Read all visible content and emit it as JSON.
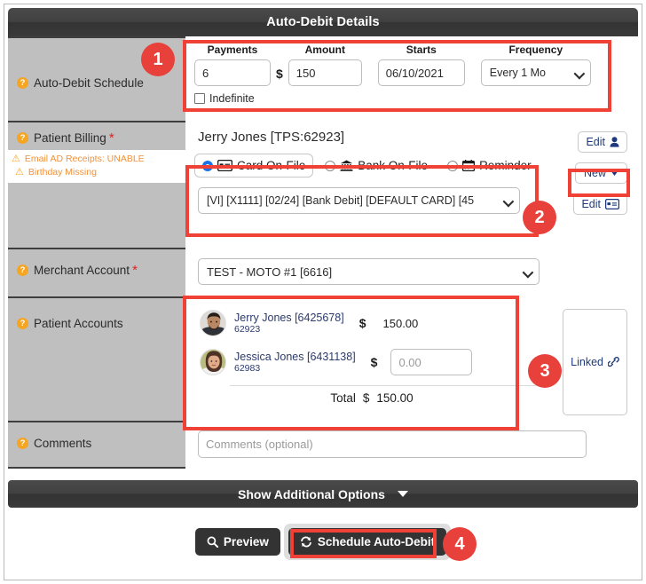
{
  "window": {
    "title": "Auto-Debit Details"
  },
  "schedule": {
    "label": "Auto-Debit Schedule",
    "help_icon": "question-circle-icon",
    "columns": {
      "payments": "Payments",
      "amount": "Amount",
      "starts": "Starts",
      "frequency": "Frequency"
    },
    "payments_value": "6",
    "currency_symbol": "$",
    "amount_value": "150",
    "starts_value": "06/10/2021",
    "frequency_value": "Every 1 Mo",
    "indefinite_label": "Indefinite",
    "indefinite_checked": false
  },
  "billing": {
    "label": "Patient Billing",
    "required_marker": "*",
    "warnings": [
      {
        "icon": "warning-triangle-icon",
        "text": "Email AD Receipts: UNABLE"
      },
      {
        "icon": "warning-triangle-icon",
        "text": "Birthday Missing"
      }
    ],
    "patient_name": "Jerry Jones [TPS:62923]",
    "edit_patient_label": "Edit",
    "edit_patient_icon": "person-icon",
    "methods": [
      {
        "label": "Card On-File",
        "icon": "credit-card-icon",
        "selected": true
      },
      {
        "label": "Bank On-File",
        "icon": "bank-icon",
        "selected": false
      },
      {
        "label": "Reminder",
        "icon": "calendar-icon",
        "selected": false
      }
    ],
    "card_value": "[VI] [X1111] [02/24] [Bank Debit] [DEFAULT CARD] [45",
    "new_label": "New",
    "new_caret_icon": "caret-down-icon",
    "edit_card_label": "Edit",
    "edit_card_icon": "credit-card-icon"
  },
  "merchant": {
    "label": "Merchant Account",
    "required_marker": "*",
    "value": "TEST - MOTO #1 [6616]"
  },
  "accounts": {
    "label": "Patient Accounts",
    "linked_label": "Linked",
    "linked_icon": "link-icon",
    "currency_symbol": "$",
    "rows": [
      {
        "name": "Jerry Jones [6425678]",
        "id": "62923",
        "amount": "150.00",
        "is_input": false,
        "avatar": "male-avatar"
      },
      {
        "name": "Jessica Jones [6431138]",
        "id": "62983",
        "amount": "",
        "placeholder": "0.00",
        "is_input": true,
        "avatar": "female-avatar"
      }
    ],
    "total_label": "Total",
    "total_amount": "150.00"
  },
  "comments": {
    "label": "Comments",
    "value": "",
    "placeholder": "Comments (optional)"
  },
  "additional_options": {
    "label": "Show Additional Options",
    "caret_icon": "caret-down-icon"
  },
  "footer": {
    "preview_label": "Preview",
    "preview_icon": "search-icon",
    "submit_label": "Schedule Auto-Debit",
    "submit_icon": "refresh-icon"
  },
  "annotations": {
    "badges": [
      "1",
      "2",
      "3",
      "4"
    ],
    "highlight_color": "#ef4136",
    "badge_color": "#e8403a"
  }
}
